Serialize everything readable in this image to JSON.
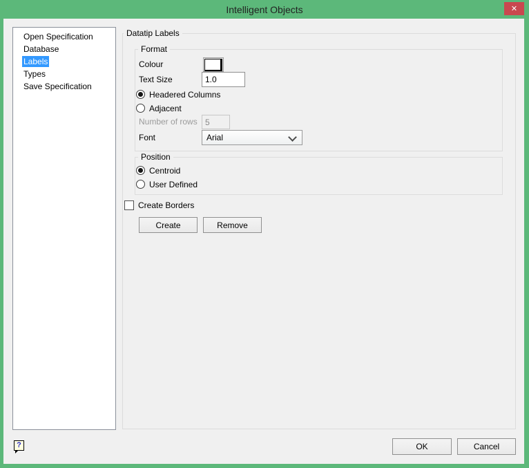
{
  "window": {
    "title": "Intelligent Objects",
    "close_glyph": "✕"
  },
  "colors": {
    "frame_green": "#5cb87a",
    "close_red": "#c9484f",
    "selection_blue": "#3399ff",
    "dialog_bg": "#f0f0f0"
  },
  "sidebar": {
    "items": [
      {
        "label": "Open Specification",
        "selected": false
      },
      {
        "label": "Database",
        "selected": false
      },
      {
        "label": "Labels",
        "selected": true
      },
      {
        "label": "Types",
        "selected": false
      },
      {
        "label": "Save Specification",
        "selected": false
      }
    ]
  },
  "main": {
    "group_title": "Datatip Labels",
    "format": {
      "title": "Format",
      "colour_label": "Colour",
      "colour_value": "#ffffff",
      "text_size_label": "Text Size",
      "text_size_value": "1.0",
      "radio_headered_label": "Headered Columns",
      "radio_headered_selected": true,
      "radio_adjacent_label": "Adjacent",
      "radio_adjacent_selected": false,
      "rows_label": "Number of rows",
      "rows_value": "5",
      "rows_enabled": false,
      "font_label": "Font",
      "font_value": "Arial"
    },
    "position": {
      "title": "Position",
      "radio_centroid_label": "Centroid",
      "radio_centroid_selected": true,
      "radio_user_defined_label": "User Defined",
      "radio_user_defined_selected": false
    },
    "create_borders_label": "Create Borders",
    "create_borders_checked": false,
    "create_button_label": "Create",
    "remove_button_label": "Remove"
  },
  "footer": {
    "help_glyph": "?",
    "ok_label": "OK",
    "cancel_label": "Cancel"
  }
}
